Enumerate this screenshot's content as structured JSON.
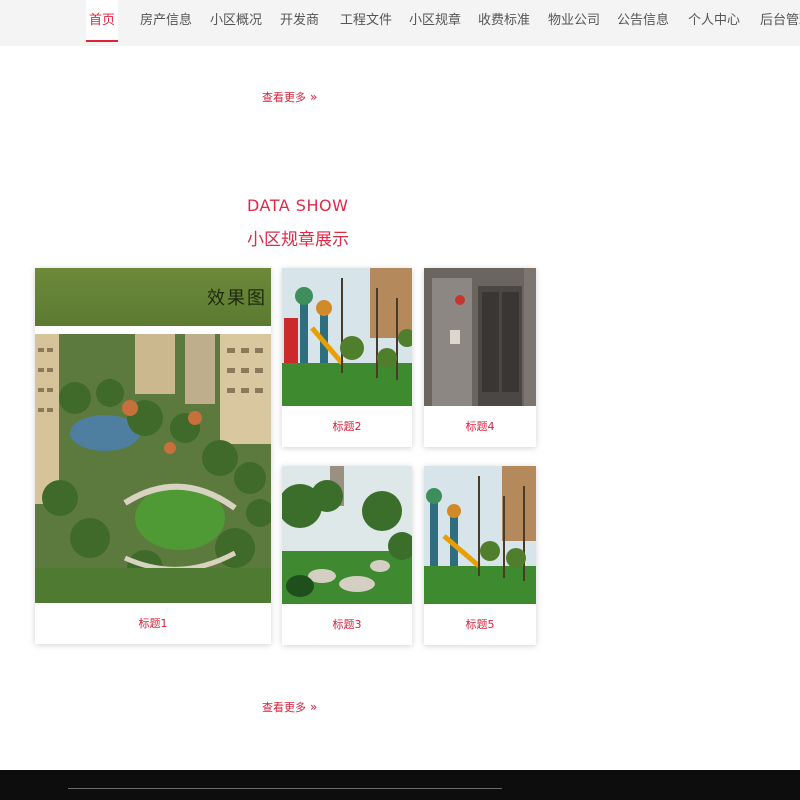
{
  "nav": {
    "items": [
      {
        "label": "首页",
        "active": true
      },
      {
        "label": "房产信息"
      },
      {
        "label": "小区概况"
      },
      {
        "label": "开发商"
      },
      {
        "label": "工程文件"
      },
      {
        "label": "小区规章"
      },
      {
        "label": "收费标准"
      },
      {
        "label": "物业公司"
      },
      {
        "label": "公告信息"
      },
      {
        "label": "个人中心"
      },
      {
        "label": "后台管理"
      }
    ]
  },
  "more_top": {
    "label": "查看更多",
    "chevron": "»"
  },
  "section": {
    "title_en": "DATA SHOW",
    "title_cn": "小区规章展示"
  },
  "cards": [
    {
      "caption": "标题1",
      "banner_text": "效果图"
    },
    {
      "caption": "标题2"
    },
    {
      "caption": "标题4"
    },
    {
      "caption": "标题3"
    },
    {
      "caption": "标题5"
    }
  ],
  "more_bottom": {
    "label": "查看更多",
    "chevron": "»"
  },
  "colors": {
    "accent": "#dd2a47",
    "nav_bg": "#f4f4f4",
    "footer_bg": "#0d0d0d"
  }
}
